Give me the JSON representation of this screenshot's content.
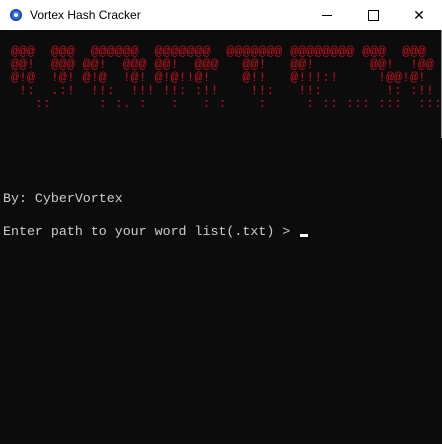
{
  "window": {
    "title": "Vortex Hash Cracker",
    "app_icon": "gear-icon",
    "minimize": "minimize-icon",
    "maximize": "maximize-icon",
    "close": "close-icon",
    "close_glyph": "✕"
  },
  "terminal": {
    "banner": " @@@  @@@  @@@@@@  @@@@@@@  @@@@@@@ @@@@@@@@ @@@  @@@\n @@!  @@@ @@!  @@@ @@!  @@@   @@!   @@!       @@!  !@@\n @!@  !@! @!@  !@! @!@!!@!    @!!   @!!!:!     !@@!@!\n  !:  .:!  !!:  !!! !!: :!!    !!:   !!:        !: :!!\n    ::      : :. :   :   : :    :     : :: ::: :::  :::",
    "author": "By: CyberVortex",
    "prompt": "Enter path to your word list(.txt) > ",
    "banner_color": "#c50f1f"
  }
}
